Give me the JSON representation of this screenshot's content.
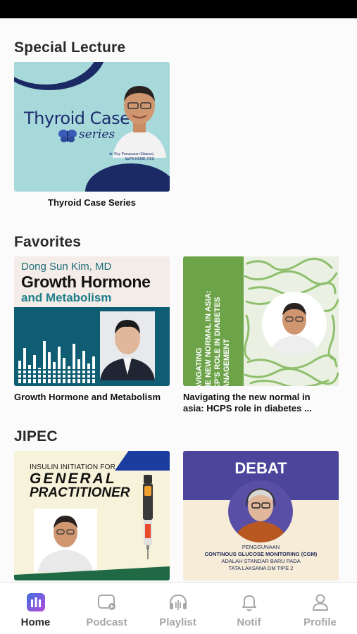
{
  "sections": {
    "special_lecture": {
      "title": "Special Lecture",
      "cards": [
        {
          "caption": "Thyroid Case Series",
          "thumb_title": "Thyroid Case",
          "thumb_subtitle": "series",
          "thumb_speaker": "dr. Roy Panusunan Sibarani,",
          "thumb_speaker_cred": "SpPD-KEMD, FES"
        }
      ]
    },
    "favorites": {
      "title": "Favorites",
      "cards": [
        {
          "caption": "Growth Hormone and Metabolism",
          "thumb_name": "Dong Sun Kim, MD",
          "thumb_title1": "Growth Hormone",
          "thumb_title2": "and Metabolism"
        },
        {
          "caption": "Navigating the new normal in",
          "caption_line2": "asia: HCPS role in diabetes ...",
          "thumb_lines": [
            "NAVIGATING",
            "THE NEW NORMAL IN ASIA:",
            "HCP'S ROLE IN DIABETES",
            "MANAGEMENT"
          ]
        }
      ]
    },
    "jipec": {
      "title": "JIPEC",
      "cards": [
        {
          "thumb_line1": "INSULIN INITIATION FOR",
          "thumb_line2": "GENERAL",
          "thumb_line3": "PRACTITIONER"
        },
        {
          "thumb_title": "DEBAT",
          "thumb_line1": "PENGGUNAAN",
          "thumb_line2": "CONTINOUS GLUCOSE MONITORING (CGM)",
          "thumb_line3": "ADALAH STANDAR BARU PADA",
          "thumb_line4": "TATA LAKSANA DM TIPE 2"
        }
      ]
    }
  },
  "tabbar": {
    "items": [
      {
        "label": "Home",
        "icon": "home-bars-icon",
        "active": true
      },
      {
        "label": "Podcast",
        "icon": "podcast-icon",
        "active": false
      },
      {
        "label": "Playlist",
        "icon": "headphones-icon",
        "active": false
      },
      {
        "label": "Notif",
        "icon": "bell-icon",
        "active": false
      },
      {
        "label": "Profile",
        "icon": "person-icon",
        "active": false
      }
    ]
  },
  "colors": {
    "active_tab_icon_start": "#3f6fe0",
    "active_tab_icon_end": "#b24bd8",
    "inactive_tab": "#a7a7a7",
    "active_tab_label": "#2b2b2b"
  }
}
